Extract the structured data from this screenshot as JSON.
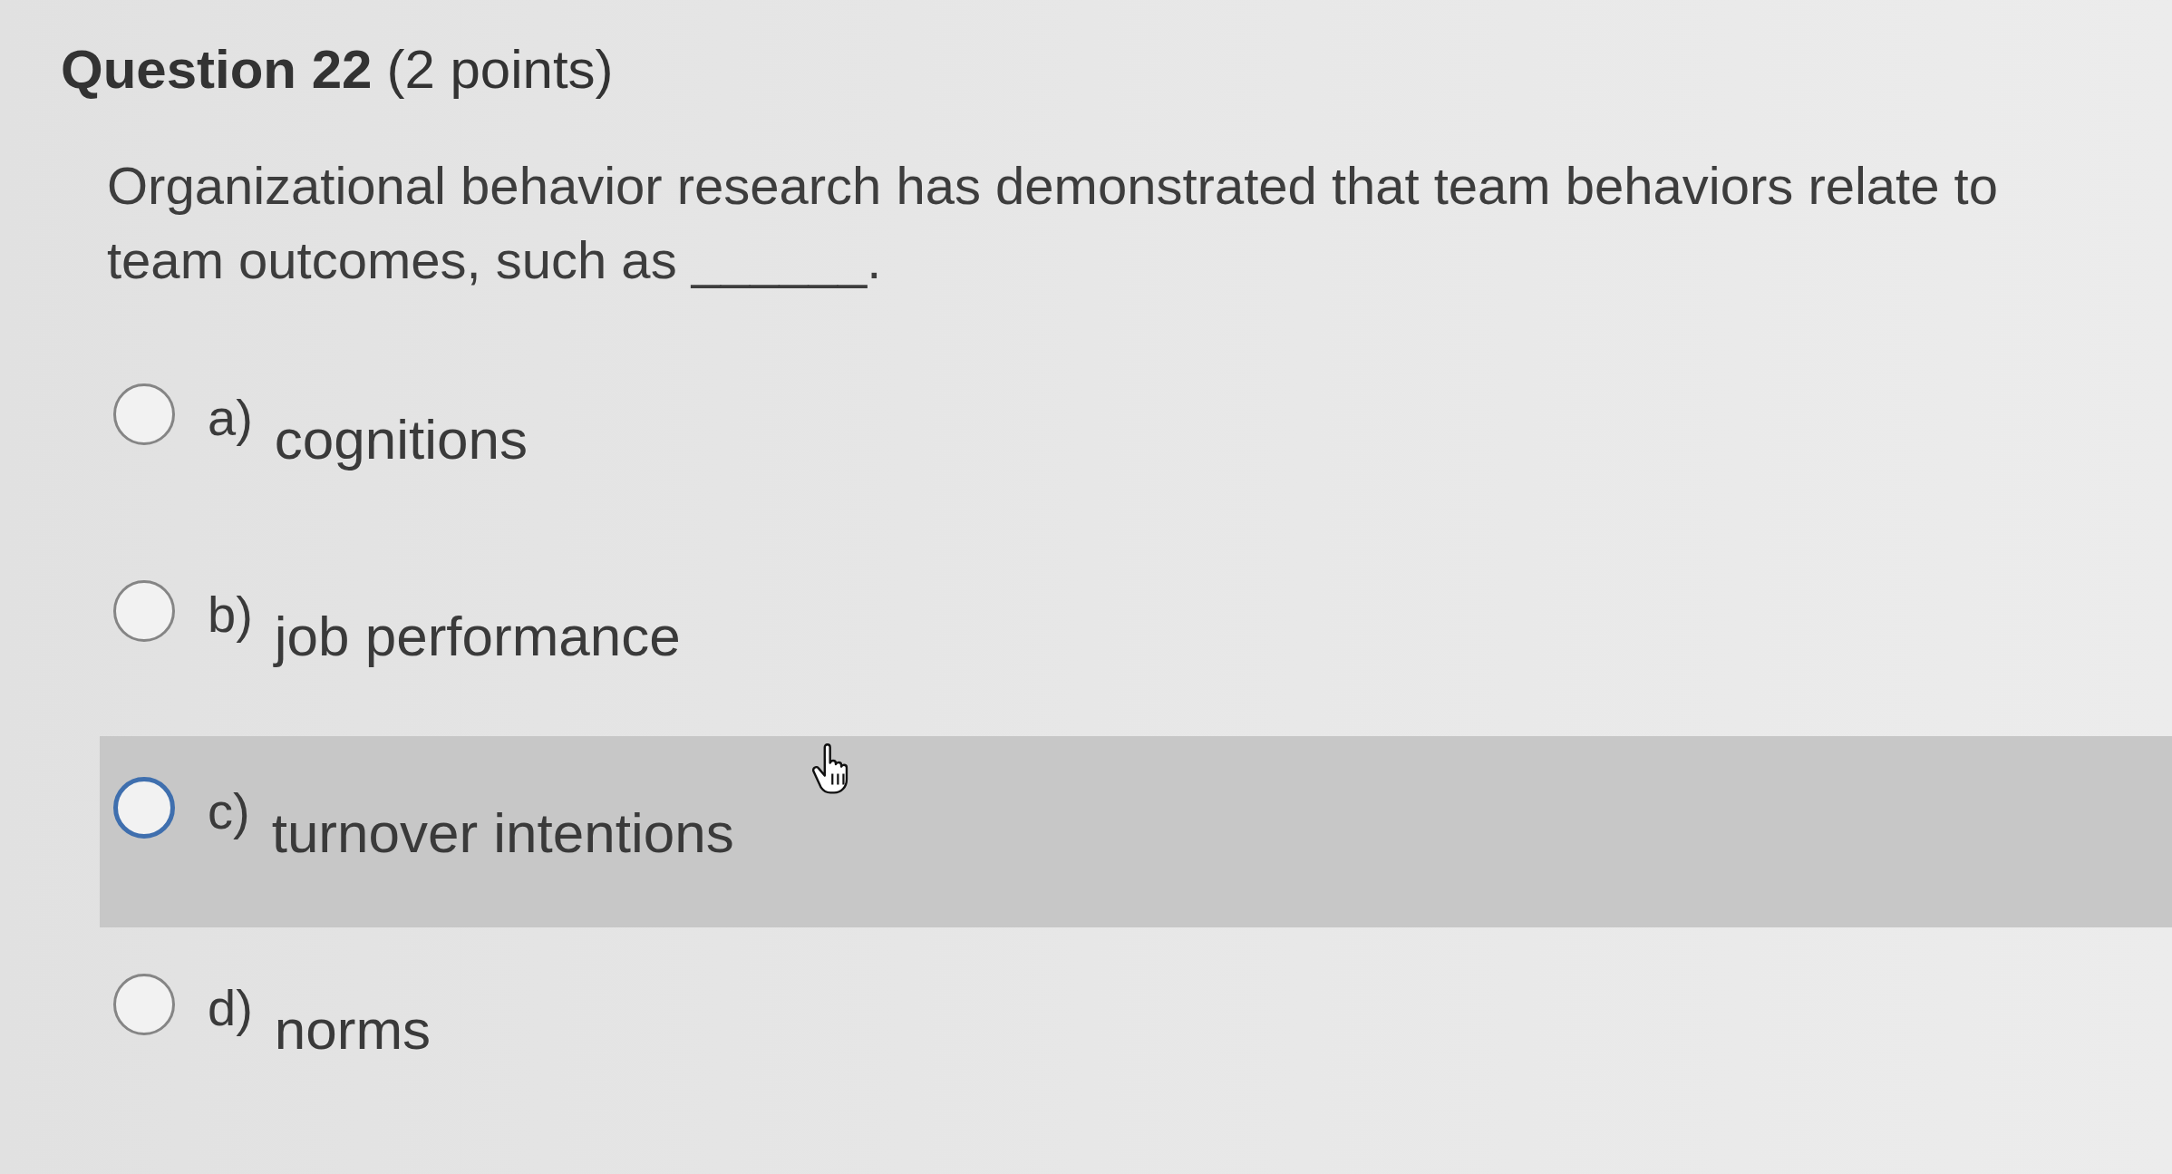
{
  "question": {
    "title": "Question 22",
    "points": "(2 points)",
    "text": "Organizational behavior research has demonstrated that team behaviors relate to team outcomes, such as ______."
  },
  "options": [
    {
      "letter": "a)",
      "text": "cognitions",
      "selected": false,
      "hovered": false
    },
    {
      "letter": "b)",
      "text": "job performance",
      "selected": false,
      "hovered": false
    },
    {
      "letter": "c)",
      "text": "turnover intentions",
      "selected": false,
      "hovered": true
    },
    {
      "letter": "d)",
      "text": "norms",
      "selected": false,
      "hovered": false
    }
  ]
}
